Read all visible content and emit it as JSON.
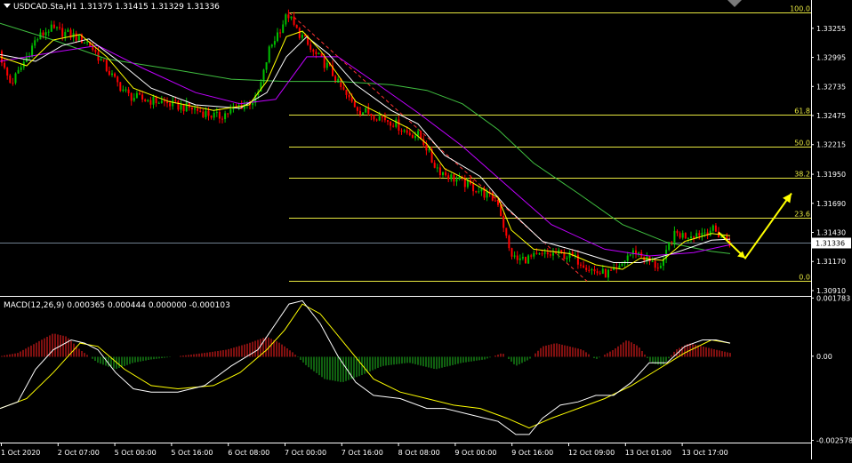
{
  "header": {
    "symbol": "USDCAD.Sta,H1",
    "ohlc": "1.31375 1.31415 1.31329 1.31336"
  },
  "macd_header": {
    "label": "MACD(12,26,9) 0.000365 0.000444 0.000000 -0.000103"
  },
  "colors": {
    "background": "#000000",
    "bull_candle": "#00c000",
    "bear_candle": "#ff0000",
    "fib": "#e8e840",
    "ma_fast": "#ffff00",
    "ma_mid": "#ffffff",
    "ma_purple": "#c000ff",
    "ma_slow": "#40c040",
    "arrow": "#ffff00",
    "hist_pos": "#ff2020",
    "hist_neg": "#20c020",
    "macd_line": "#ffffff",
    "signal_line": "#ffff00"
  },
  "chart_data": [
    {
      "type": "candlestick",
      "instrument": "USDCAD",
      "timeframe": "H1",
      "current_price": "1.31336",
      "y_axis_ticks": [
        "1.33255",
        "1.32995",
        "1.32735",
        "1.32475",
        "1.32215",
        "1.31950",
        "1.31690",
        "1.31430",
        "1.31170",
        "1.30910"
      ],
      "x_axis_ticks": [
        "1 Oct 2020",
        "2 Oct 07:00",
        "5 Oct 00:00",
        "5 Oct 16:00",
        "6 Oct 08:00",
        "7 Oct 00:00",
        "7 Oct 16:00",
        "8 Oct 08:00",
        "9 Oct 00:00",
        "9 Oct 16:00",
        "12 Oct 09:00",
        "13 Oct 01:00",
        "13 Oct 17:00"
      ],
      "ylim": [
        1.3087,
        1.335
      ],
      "price_path": [
        [
          0,
          1.3305
        ],
        [
          4,
          1.329
        ],
        [
          12,
          1.3276
        ],
        [
          20,
          1.3285
        ],
        [
          30,
          1.33
        ],
        [
          40,
          1.3315
        ],
        [
          55,
          1.3325
        ],
        [
          70,
          1.3322
        ],
        [
          85,
          1.3318
        ],
        [
          100,
          1.3312
        ],
        [
          115,
          1.3295
        ],
        [
          130,
          1.3278
        ],
        [
          145,
          1.3265
        ],
        [
          160,
          1.3262
        ],
        [
          180,
          1.326
        ],
        [
          200,
          1.3256
        ],
        [
          215,
          1.3254
        ],
        [
          230,
          1.325
        ],
        [
          245,
          1.3246
        ],
        [
          260,
          1.3252
        ],
        [
          275,
          1.3258
        ],
        [
          288,
          1.3262
        ],
        [
          295,
          1.328
        ],
        [
          302,
          1.3305
        ],
        [
          310,
          1.3318
        ],
        [
          318,
          1.333
        ],
        [
          324,
          1.3338
        ],
        [
          332,
          1.3325
        ],
        [
          340,
          1.3318
        ],
        [
          350,
          1.3305
        ],
        [
          360,
          1.3298
        ],
        [
          370,
          1.329
        ],
        [
          380,
          1.3276
        ],
        [
          392,
          1.3262
        ],
        [
          405,
          1.3252
        ],
        [
          418,
          1.3249
        ],
        [
          432,
          1.3245
        ],
        [
          445,
          1.324
        ],
        [
          458,
          1.3232
        ],
        [
          470,
          1.323
        ],
        [
          478,
          1.3222
        ],
        [
          486,
          1.3206
        ],
        [
          495,
          1.3198
        ],
        [
          508,
          1.3192
        ],
        [
          520,
          1.3188
        ],
        [
          535,
          1.3182
        ],
        [
          548,
          1.3176
        ],
        [
          560,
          1.317
        ],
        [
          566,
          1.315
        ],
        [
          572,
          1.3128
        ],
        [
          580,
          1.3118
        ],
        [
          595,
          1.312
        ],
        [
          610,
          1.3122
        ],
        [
          625,
          1.3124
        ],
        [
          640,
          1.3122
        ],
        [
          655,
          1.3116
        ],
        [
          668,
          1.3108
        ],
        [
          680,
          1.3106
        ],
        [
          695,
          1.3108
        ],
        [
          705,
          1.3122
        ],
        [
          715,
          1.3126
        ],
        [
          725,
          1.312
        ],
        [
          735,
          1.3114
        ],
        [
          745,
          1.3112
        ],
        [
          752,
          1.3132
        ],
        [
          760,
          1.3142
        ],
        [
          770,
          1.314
        ],
        [
          780,
          1.3142
        ],
        [
          790,
          1.3143
        ],
        [
          800,
          1.3146
        ],
        [
          810,
          1.314
        ],
        [
          818,
          1.3136
        ],
        [
          821,
          1.3134
        ]
      ],
      "ma_fast_path": [
        [
          0,
          1.33
        ],
        [
          30,
          1.3292
        ],
        [
          60,
          1.3315
        ],
        [
          90,
          1.332
        ],
        [
          120,
          1.33
        ],
        [
          150,
          1.3272
        ],
        [
          190,
          1.326
        ],
        [
          240,
          1.3252
        ],
        [
          280,
          1.3257
        ],
        [
          300,
          1.3278
        ],
        [
          322,
          1.3318
        ],
        [
          340,
          1.3323
        ],
        [
          360,
          1.3306
        ],
        [
          380,
          1.3284
        ],
        [
          400,
          1.326
        ],
        [
          430,
          1.3248
        ],
        [
          460,
          1.3236
        ],
        [
          480,
          1.3222
        ],
        [
          500,
          1.32
        ],
        [
          530,
          1.3188
        ],
        [
          560,
          1.3174
        ],
        [
          575,
          1.3145
        ],
        [
          600,
          1.3128
        ],
        [
          640,
          1.3124
        ],
        [
          670,
          1.3114
        ],
        [
          700,
          1.311
        ],
        [
          720,
          1.312
        ],
        [
          745,
          1.3118
        ],
        [
          770,
          1.3135
        ],
        [
          800,
          1.3142
        ],
        [
          821,
          1.314
        ]
      ],
      "ma_mid_path": [
        [
          0,
          1.3302
        ],
        [
          40,
          1.3296
        ],
        [
          70,
          1.331
        ],
        [
          100,
          1.3316
        ],
        [
          130,
          1.3298
        ],
        [
          170,
          1.3272
        ],
        [
          220,
          1.3257
        ],
        [
          270,
          1.3254
        ],
        [
          300,
          1.3268
        ],
        [
          322,
          1.33
        ],
        [
          345,
          1.3318
        ],
        [
          370,
          1.3302
        ],
        [
          400,
          1.3275
        ],
        [
          440,
          1.3252
        ],
        [
          470,
          1.324
        ],
        [
          500,
          1.3212
        ],
        [
          540,
          1.3193
        ],
        [
          570,
          1.3165
        ],
        [
          610,
          1.3135
        ],
        [
          650,
          1.3126
        ],
        [
          690,
          1.3116
        ],
        [
          720,
          1.3116
        ],
        [
          760,
          1.3125
        ],
        [
          800,
          1.3136
        ],
        [
          821,
          1.3137
        ]
      ],
      "ma_purple_path": [
        [
          0,
          1.3296
        ],
        [
          60,
          1.3304
        ],
        [
          110,
          1.331
        ],
        [
          160,
          1.329
        ],
        [
          220,
          1.3268
        ],
        [
          270,
          1.3258
        ],
        [
          310,
          1.3262
        ],
        [
          345,
          1.33
        ],
        [
          380,
          1.33
        ],
        [
          420,
          1.3278
        ],
        [
          470,
          1.325
        ],
        [
          520,
          1.322
        ],
        [
          570,
          1.3185
        ],
        [
          620,
          1.315
        ],
        [
          680,
          1.3128
        ],
        [
          730,
          1.3122
        ],
        [
          780,
          1.3125
        ],
        [
          821,
          1.3132
        ]
      ],
      "ma_slow_path": [
        [
          0,
          1.333
        ],
        [
          60,
          1.3315
        ],
        [
          120,
          1.3298
        ],
        [
          200,
          1.3288
        ],
        [
          260,
          1.328
        ],
        [
          320,
          1.3278
        ],
        [
          380,
          1.3278
        ],
        [
          440,
          1.3275
        ],
        [
          480,
          1.327
        ],
        [
          520,
          1.3258
        ],
        [
          560,
          1.3235
        ],
        [
          600,
          1.3205
        ],
        [
          650,
          1.3178
        ],
        [
          700,
          1.315
        ],
        [
          750,
          1.3134
        ],
        [
          800,
          1.3126
        ],
        [
          821,
          1.3124
        ]
      ],
      "fibonacci": {
        "high": 1.33395,
        "low": 1.30994,
        "levels": [
          {
            "label": "100.0",
            "value": 1.33395
          },
          {
            "label": "61.8",
            "value": 1.32485
          },
          {
            "label": "50.0",
            "value": 1.322
          },
          {
            "label": "38.2",
            "value": 1.31915
          },
          {
            "label": "23.6",
            "value": 1.3156
          },
          {
            "label": "0.0",
            "value": 1.30994
          }
        ]
      },
      "forecast_arrow": [
        [
          808,
          1.3143
        ],
        [
          838,
          1.312
        ],
        [
          890,
          1.3178
        ]
      ]
    },
    {
      "type": "macd",
      "params": "MACD(12,26,9)",
      "y_axis_ticks": [
        "0.001783",
        "0.00",
        "-0.002578"
      ],
      "ylim": [
        -0.00262,
        0.00182
      ],
      "macd_path": [
        [
          0,
          -0.0016
        ],
        [
          20,
          -0.0014
        ],
        [
          40,
          -0.0004
        ],
        [
          60,
          0.0002
        ],
        [
          80,
          0.0005
        ],
        [
          95,
          0.0004
        ],
        [
          110,
          0.0002
        ],
        [
          130,
          -0.0005
        ],
        [
          150,
          -0.001
        ],
        [
          170,
          -0.0011
        ],
        [
          200,
          -0.0011
        ],
        [
          230,
          -0.0009
        ],
        [
          260,
          -0.0003
        ],
        [
          290,
          0.0002
        ],
        [
          310,
          0.001
        ],
        [
          325,
          0.0016
        ],
        [
          340,
          0.0017
        ],
        [
          360,
          0.001
        ],
        [
          380,
          0.0
        ],
        [
          400,
          -0.0008
        ],
        [
          420,
          -0.0012
        ],
        [
          450,
          -0.0013
        ],
        [
          480,
          -0.0016
        ],
        [
          500,
          -0.0016
        ],
        [
          530,
          -0.0018
        ],
        [
          560,
          -0.002
        ],
        [
          580,
          -0.0024
        ],
        [
          595,
          -0.0024
        ],
        [
          610,
          -0.0019
        ],
        [
          630,
          -0.0015
        ],
        [
          650,
          -0.0014
        ],
        [
          670,
          -0.0012
        ],
        [
          690,
          -0.0012
        ],
        [
          710,
          -0.0008
        ],
        [
          730,
          -0.0002
        ],
        [
          750,
          -0.0002
        ],
        [
          770,
          0.0003
        ],
        [
          790,
          0.0005
        ],
        [
          805,
          0.0005
        ],
        [
          821,
          0.0004
        ]
      ],
      "signal_path": [
        [
          0,
          -0.0016
        ],
        [
          30,
          -0.0013
        ],
        [
          60,
          -0.0005
        ],
        [
          90,
          0.0004
        ],
        [
          110,
          0.0003
        ],
        [
          140,
          -0.0004
        ],
        [
          170,
          -0.0009
        ],
        [
          200,
          -0.001
        ],
        [
          240,
          -0.0009
        ],
        [
          270,
          -0.0005
        ],
        [
          300,
          0.0002
        ],
        [
          320,
          0.0008
        ],
        [
          340,
          0.0016
        ],
        [
          360,
          0.0013
        ],
        [
          390,
          0.0003
        ],
        [
          420,
          -0.0007
        ],
        [
          450,
          -0.0011
        ],
        [
          480,
          -0.0013
        ],
        [
          510,
          -0.0015
        ],
        [
          540,
          -0.0016
        ],
        [
          570,
          -0.0019
        ],
        [
          595,
          -0.0022
        ],
        [
          620,
          -0.0019
        ],
        [
          650,
          -0.0016
        ],
        [
          680,
          -0.0013
        ],
        [
          710,
          -0.0009
        ],
        [
          740,
          -0.0004
        ],
        [
          770,
          0.0001
        ],
        [
          800,
          0.0005
        ],
        [
          821,
          0.0004
        ]
      ],
      "histogram_envelope": [
        [
          0,
          0.0
        ],
        [
          20,
          0.0001
        ],
        [
          40,
          0.0004
        ],
        [
          60,
          0.0007
        ],
        [
          75,
          0.0006
        ],
        [
          90,
          0.0002
        ],
        [
          110,
          -0.0002
        ],
        [
          130,
          -0.0004
        ],
        [
          150,
          -0.0002
        ],
        [
          170,
          -0.0001
        ],
        [
          200,
          0.0
        ],
        [
          230,
          0.0001
        ],
        [
          255,
          0.0002
        ],
        [
          280,
          0.0004
        ],
        [
          300,
          0.0006
        ],
        [
          315,
          0.0004
        ],
        [
          330,
          0.0001
        ],
        [
          345,
          -0.0003
        ],
        [
          365,
          -0.0007
        ],
        [
          385,
          -0.0008
        ],
        [
          405,
          -0.0006
        ],
        [
          430,
          -0.0003
        ],
        [
          460,
          -0.0002
        ],
        [
          490,
          -0.0004
        ],
        [
          520,
          -0.0002
        ],
        [
          545,
          -0.0001
        ],
        [
          565,
          0.0001
        ],
        [
          580,
          -0.0003
        ],
        [
          595,
          -0.0001
        ],
        [
          610,
          0.0003
        ],
        [
          625,
          0.0004
        ],
        [
          640,
          0.0003
        ],
        [
          655,
          0.0002
        ],
        [
          670,
          -0.0001
        ],
        [
          690,
          0.0002
        ],
        [
          705,
          0.0005
        ],
        [
          718,
          0.0003
        ],
        [
          732,
          -0.0002
        ],
        [
          745,
          -0.0003
        ],
        [
          760,
          0.0002
        ],
        [
          775,
          0.0004
        ],
        [
          790,
          0.0003
        ],
        [
          805,
          0.0002
        ],
        [
          821,
          0.0001
        ]
      ]
    }
  ]
}
